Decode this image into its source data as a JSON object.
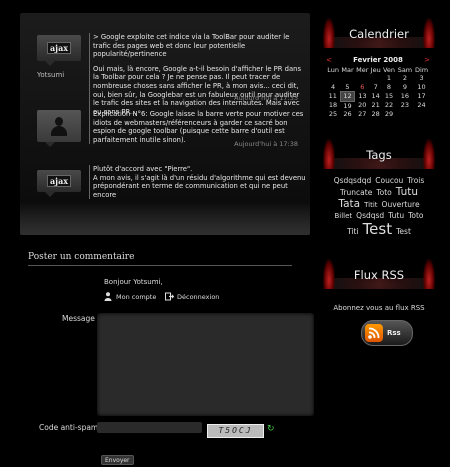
{
  "comments": [
    {
      "author": "Yotsumi",
      "avatar": "ajax",
      "p1": "> Google exploite cet indice via la ToolBar pour auditer le trafic des pages web et donc leur potentielle popularité/pertinence",
      "p2": "Oui mais, là encore, Google a-t-il besoin d'afficher le PR dans la Toolbar pour cela ? Je ne pense pas. Il peut tracer de nombreuse choses sans afficher le PR, à mon avis... ceci dit, oui, bien sûr, la Googlebar est un fabuleux outil pour auditer le trafic des sites et la navigation des internautes. Mais avec ou sans PR...",
      "date": "Aujourd'hui à 17:33"
    },
    {
      "author": "",
      "avatar": "silhouette",
      "p1": "Explication N°6: Google laisse la barre verte pour motiver ces idiots de webmasters/référenceurs à garder ce sacré bon espion de google toolbar (puisque cette barre d'outil est parfaitement inutile sinon).",
      "date": "Aujourd'hui à 17:38"
    },
    {
      "author": "",
      "avatar": "ajax",
      "p1": "Plutôt d'accord avec \"Pierre\".",
      "p2": "A mon avis, il s'agit là d'un résidu d'algorithme qui est devenu prépondérant en terme de communication et qui ne peut encore"
    }
  ],
  "form": {
    "title": "Poster un commentaire",
    "greeting": "Bonjour Yotsumi,",
    "account_link": "Mon compte",
    "logout_link": "Déconnexion",
    "message_label": "Message",
    "antispam_label": "Code anti-spam",
    "captcha": "T5OCJ",
    "submit": "Envoyer"
  },
  "calendar": {
    "title": "Calendrier",
    "prev": "<",
    "next": ">",
    "month": "Fevrier 2008",
    "days": [
      "Lun",
      "Mar",
      "Mer",
      "Jeu",
      "Ven",
      "Sam",
      "Dim"
    ],
    "weeks": [
      [
        "",
        "",
        "",
        "",
        "1",
        "2",
        "3"
      ],
      [
        "4",
        "5",
        "6",
        "7",
        "8",
        "9",
        "10"
      ],
      [
        "11",
        "12",
        "13",
        "14",
        "15",
        "16",
        "17"
      ],
      [
        "18",
        "19",
        "20",
        "21",
        "22",
        "23",
        "24"
      ],
      [
        "25",
        "26",
        "27",
        "28",
        "29",
        "",
        ""
      ]
    ],
    "highlighted": [
      "6"
    ],
    "today": "12",
    "accent_color": "#e33333"
  },
  "tags": {
    "title": "Tags",
    "items": [
      {
        "label": "Qsdqsdqd",
        "size": 7.5
      },
      {
        "label": "Coucou",
        "size": 7.5
      },
      {
        "label": "Trois",
        "size": 7.5
      },
      {
        "label": "Truncate",
        "size": 7.5
      },
      {
        "label": "Toto",
        "size": 7.5
      },
      {
        "label": "Tutu",
        "size": 10.5
      },
      {
        "label": "Tata",
        "size": 10.5
      },
      {
        "label": "Titit",
        "size": 7
      },
      {
        "label": "Ouverture",
        "size": 7.5
      },
      {
        "label": "Billet",
        "size": 7
      },
      {
        "label": "Qsdqsd",
        "size": 7.5
      },
      {
        "label": "Tutu",
        "size": 7.5
      },
      {
        "label": "Toto",
        "size": 7.5
      },
      {
        "label": "Titi",
        "size": 7.5
      },
      {
        "label": "Test",
        "size": 15
      },
      {
        "label": "Test",
        "size": 7.5
      }
    ]
  },
  "rss": {
    "title": "Flux RSS",
    "text": "Abonnez vous au flux RSS",
    "button": "Rss"
  }
}
